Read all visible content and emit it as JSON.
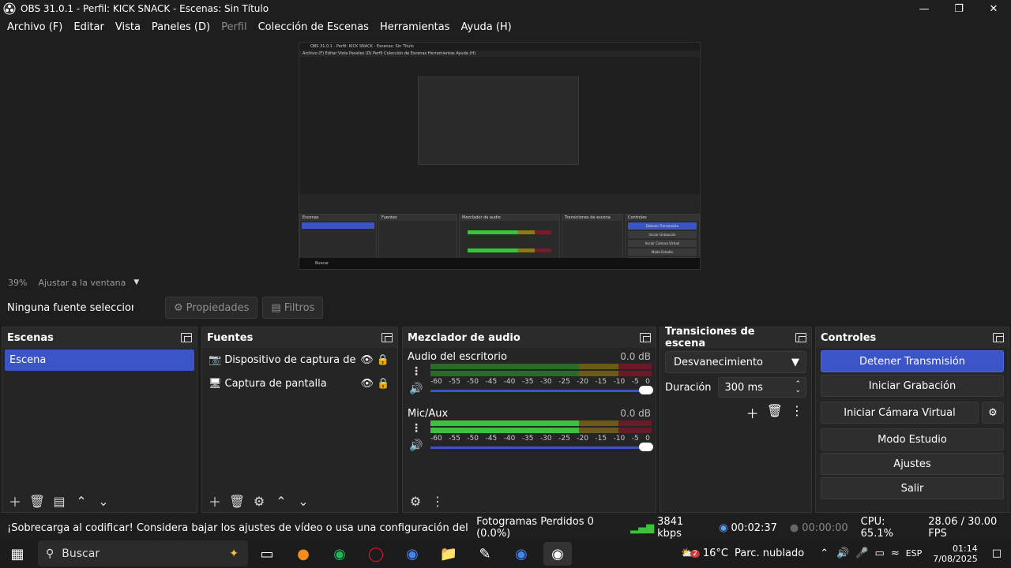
{
  "window": {
    "title": "OBS 31.0.1 - Perfil: KICK SNACK - Escenas: Sin Título"
  },
  "menu": [
    "Archivo (F)",
    "Editar",
    "Vista",
    "Paneles (D)",
    "Perfil",
    "Colección de Escenas",
    "Herramientas",
    "Ayuda (H)"
  ],
  "preview": {
    "zoom": "39%",
    "fit_label": "Ajustar a la ventana"
  },
  "sourcebar": {
    "no_source": "Ninguna fuente seleccionada",
    "properties": "Propiedades",
    "filters": "Filtros"
  },
  "scenes": {
    "title": "Escenas",
    "items": [
      "Escena"
    ]
  },
  "sources": {
    "title": "Fuentes",
    "items": [
      "Dispositivo de captura de video",
      "Captura de pantalla"
    ]
  },
  "mixer": {
    "title": "Mezclador de audio",
    "channels": [
      {
        "name": "Audio del escritorio",
        "db": "0.0 dB"
      },
      {
        "name": "Mic/Aux",
        "db": "0.0 dB"
      }
    ],
    "scale": [
      "-60",
      "-55",
      "-50",
      "-45",
      "-40",
      "-35",
      "-30",
      "-25",
      "-20",
      "-15",
      "-10",
      "-5",
      "0"
    ]
  },
  "transitions": {
    "title": "Transiciones de escena",
    "selected": "Desvanecimiento",
    "duration_label": "Duración",
    "duration_value": "300 ms"
  },
  "controls": {
    "title": "Controles",
    "buttons": [
      "Detener Transmisión",
      "Iniciar Grabación",
      "Iniciar Cámara Virtual",
      "Modo Estudio",
      "Ajustes",
      "Salir"
    ]
  },
  "status": {
    "warning": "¡Sobrecarga al codificar! Considera bajar los ajustes de vídeo o usa una configuración del codificador más rápida.",
    "dropped": "Fotogramas Perdidos 0 (0.0%)",
    "bitrate": "3841 kbps",
    "stream_time": "00:02:37",
    "rec_time": "00:00:00",
    "cpu": "CPU: 65.1%",
    "fps": "28.06 / 30.00 FPS"
  },
  "taskbar": {
    "search": "Buscar",
    "weather": "16°C",
    "weather_desc": "Parc. nublado",
    "lang": "ESP",
    "time": "01:14",
    "date": "7/08/2025",
    "weather_badge": "2"
  },
  "colors": {
    "accent": "#3b55c9",
    "bg": "#1f1e1f",
    "meter_green": "#3ac43a",
    "meter_yellow": "#8a7a1a",
    "meter_red": "#7a1a2a"
  }
}
